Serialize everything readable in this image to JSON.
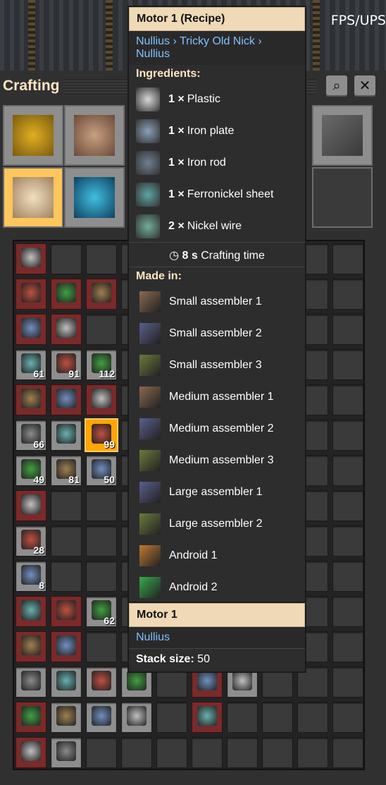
{
  "hud": {
    "fps_label": "FPS/UPS"
  },
  "window": {
    "title": "Crafting",
    "search_icon": "⌕",
    "close_icon": "✕"
  },
  "recipe_tooltip": {
    "title": "Motor 1 (Recipe)",
    "breadcrumb": "Nullius › Tricky Old Nick › Nullius",
    "ingredients_header": "Ingredients:",
    "ingredients": [
      {
        "qty": "1 ×",
        "name": "Plastic",
        "color": "#d8d8d8",
        "icon": "plastic-icon"
      },
      {
        "qty": "1 ×",
        "name": "Iron plate",
        "color": "#8aa0b8",
        "icon": "iron-plate-icon"
      },
      {
        "qty": "1 ×",
        "name": "Iron rod",
        "color": "#6f7f90",
        "icon": "iron-rod-icon"
      },
      {
        "qty": "1 ×",
        "name": "Ferronickel sheet",
        "color": "#5fa3a3",
        "icon": "ferronickel-sheet-icon"
      },
      {
        "qty": "2 ×",
        "name": "Nickel wire",
        "color": "#6fae9a",
        "icon": "nickel-wire-icon"
      }
    ],
    "time_value": "8 s",
    "time_label": "Crafting time",
    "made_in_header": "Made in:",
    "made_in": [
      {
        "name": "Small assembler 1",
        "color": "#8b6a50"
      },
      {
        "name": "Small assembler 2",
        "color": "#5a5f8b"
      },
      {
        "name": "Small assembler 3",
        "color": "#6a7b3a"
      },
      {
        "name": "Medium assembler 1",
        "color": "#8b6a50"
      },
      {
        "name": "Medium assembler 2",
        "color": "#5a5f8b"
      },
      {
        "name": "Medium assembler 3",
        "color": "#6a7b3a"
      },
      {
        "name": "Large assembler 1",
        "color": "#5a5f8b"
      },
      {
        "name": "Large assembler 2",
        "color": "#6a7b3a"
      },
      {
        "name": "Android 1",
        "color": "#c07a30"
      },
      {
        "name": "Android 2",
        "color": "#3aa84a"
      }
    ]
  },
  "item_tooltip": {
    "title": "Motor 1",
    "mod": "Nullius",
    "stack_label": "Stack size:",
    "stack_value": "50"
  },
  "slot_counts": {
    "r4a": "61",
    "r4b": "91",
    "r4c": "112",
    "r6a": "66",
    "r6c": "99",
    "r7a": "49",
    "r7b": "81",
    "r7c": "50",
    "r9a": "28",
    "r10a": "8",
    "r11c": "62"
  }
}
